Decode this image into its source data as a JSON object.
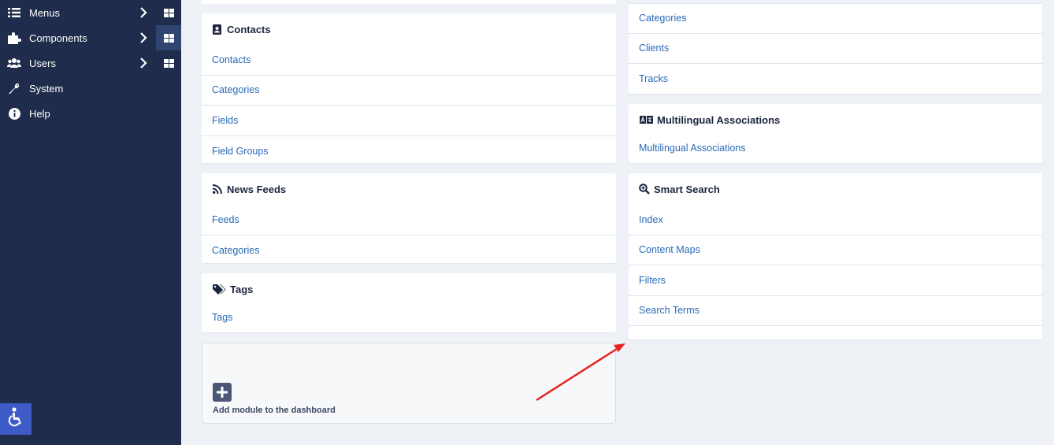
{
  "sidebar": {
    "items": [
      {
        "label": "Menus",
        "icon": "list-icon"
      },
      {
        "label": "Components",
        "icon": "puzzle-icon"
      },
      {
        "label": "Users",
        "icon": "users-icon"
      },
      {
        "label": "System",
        "icon": "wrench-icon"
      },
      {
        "label": "Help",
        "icon": "info-icon"
      }
    ],
    "accessibility_icon": "accessibility-icon"
  },
  "left_column": {
    "contacts": {
      "title": "Contacts",
      "links": [
        "Contacts",
        "Categories",
        "Fields",
        "Field Groups"
      ]
    },
    "news_feeds": {
      "title": "News Feeds",
      "links": [
        "Feeds",
        "Categories"
      ]
    },
    "tags": {
      "title": "Tags",
      "links": [
        "Tags"
      ]
    },
    "add_module": {
      "label": "Add module to the dashboard"
    }
  },
  "right_column": {
    "banners": {
      "links": [
        "Categories",
        "Clients",
        "Tracks"
      ]
    },
    "multilingual": {
      "title": "Multilingual Associations",
      "links": [
        "Multilingual Associations"
      ]
    },
    "smart_search": {
      "title": "Smart Search",
      "links": [
        "Index",
        "Content Maps",
        "Filters",
        "Search Terms"
      ]
    }
  },
  "colors": {
    "sidebar_bg": "#1f2c4b",
    "link": "#2a69b8",
    "page_bg": "#eef2f7",
    "annotation_arrow": "#e8231f"
  }
}
